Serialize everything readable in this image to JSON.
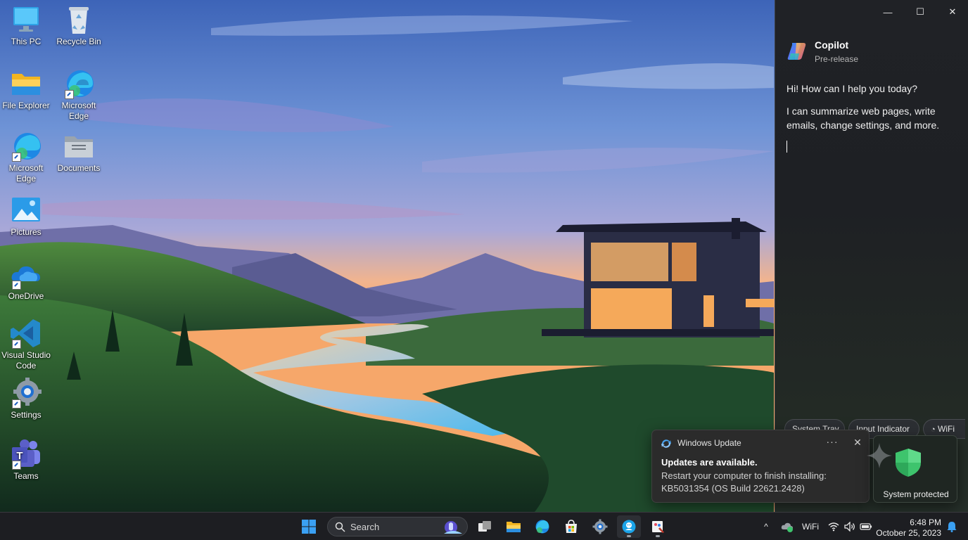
{
  "desktop": {
    "icons": [
      {
        "label": "This PC",
        "icon": "monitor-icon"
      },
      {
        "label": "Recycle Bin",
        "icon": "recycle-bin-icon"
      },
      {
        "label": "File Explorer",
        "icon": "folder-icon"
      },
      {
        "label": "Microsoft Edge",
        "icon": "edge-icon"
      },
      {
        "label": "Microsoft Edge",
        "icon": "edge-icon"
      },
      {
        "label": "Documents",
        "icon": "documents-folder-icon"
      },
      {
        "label": "Pictures",
        "icon": "pictures-icon"
      },
      {
        "label": "OneDrive",
        "icon": "onedrive-icon"
      },
      {
        "label": "Visual Studio Code",
        "icon": "vscode-icon"
      },
      {
        "label": "Settings",
        "icon": "gear-icon"
      },
      {
        "label": "Teams",
        "icon": "teams-icon"
      }
    ]
  },
  "copilot": {
    "title": "Copilot",
    "subtitle": "Pre-release",
    "greeting": "Hi! How can I help you today?",
    "intro": "I can summarize web pages, write emails, change settings, and more.",
    "window_controls": {
      "minimize": "—",
      "maximize": "☐",
      "close": "✕"
    },
    "suggestions": [
      "System Tray",
      "Input Indicator",
      "WiFi"
    ]
  },
  "toast": {
    "app": "Windows Update",
    "more": "···",
    "close": "✕",
    "title": "Updates are available.",
    "body": "Restart your computer to finish installing: KB5031354 (OS Build 22621.2428)"
  },
  "security_card": {
    "label": "System protected",
    "accent": "#3ec46d"
  },
  "taskbar": {
    "search_label": "Search",
    "pinned": [
      "start-icon",
      "task-view-icon",
      "file-explorer-icon",
      "edge-icon",
      "microsoft-store-icon",
      "settings-icon",
      "copilot-icon",
      "paint-icon"
    ],
    "tray": {
      "chevron": "^",
      "wifi_label": "WiFi",
      "time": "6:48 PM",
      "date": "October 25, 2023"
    }
  },
  "colors": {
    "accent": "#0078d4",
    "taskbar_bg": "#1d1e22",
    "pane_bg": "#202226"
  }
}
